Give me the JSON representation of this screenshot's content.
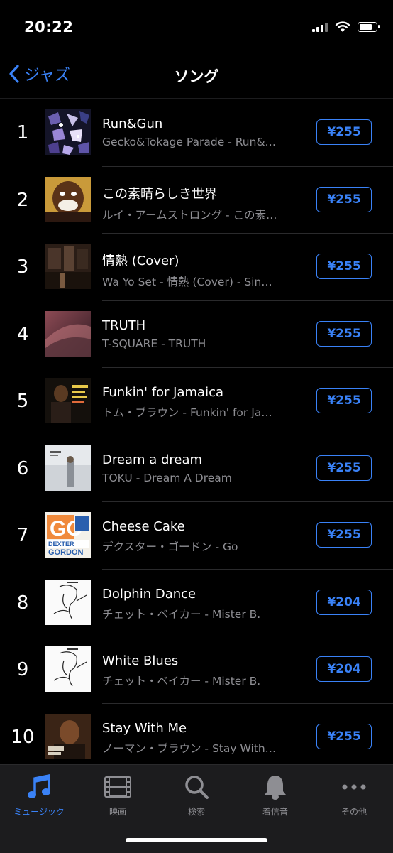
{
  "status": {
    "time": "20:22"
  },
  "nav": {
    "back_label": "ジャズ",
    "title": "ソング"
  },
  "songs": [
    {
      "rank": "1",
      "title": "Run&Gun",
      "subtitle": "Gecko&Tokage Parade - Run&…",
      "price": "¥255"
    },
    {
      "rank": "2",
      "title": "この素晴らしき世界",
      "subtitle": "ルイ・アームストロング - この素…",
      "price": "¥255"
    },
    {
      "rank": "3",
      "title": "情熱 (Cover)",
      "subtitle": "Wa Yo Set - 情熱 (Cover) - Sin…",
      "price": "¥255"
    },
    {
      "rank": "4",
      "title": "TRUTH",
      "subtitle": "T-SQUARE - TRUTH",
      "price": "¥255"
    },
    {
      "rank": "5",
      "title": "Funkin' for Jamaica",
      "subtitle": "トム・ブラウン - Funkin' for Ja…",
      "price": "¥255"
    },
    {
      "rank": "6",
      "title": "Dream a dream",
      "subtitle": "TOKU - Dream A Dream",
      "price": "¥255"
    },
    {
      "rank": "7",
      "title": "Cheese Cake",
      "subtitle": "デクスター・ゴードン - Go",
      "price": "¥255"
    },
    {
      "rank": "8",
      "title": "Dolphin Dance",
      "subtitle": "チェット・ベイカー - Mister B.",
      "price": "¥204"
    },
    {
      "rank": "9",
      "title": "White Blues",
      "subtitle": "チェット・ベイカー - Mister B.",
      "price": "¥204"
    },
    {
      "rank": "10",
      "title": "Stay With Me",
      "subtitle": "ノーマン・ブラウン - Stay With…",
      "price": "¥255"
    }
  ],
  "tabs": [
    {
      "label": "ミュージック",
      "icon": "music-note-icon",
      "active": true
    },
    {
      "label": "映画",
      "icon": "film-icon",
      "active": false
    },
    {
      "label": "検索",
      "icon": "search-icon",
      "active": false
    },
    {
      "label": "着信音",
      "icon": "bell-icon",
      "active": false
    },
    {
      "label": "その他",
      "icon": "more-icon",
      "active": false
    }
  ],
  "colors": {
    "accent": "#3a82f7",
    "background": "#000000",
    "secondary_text": "#8e8e93"
  }
}
